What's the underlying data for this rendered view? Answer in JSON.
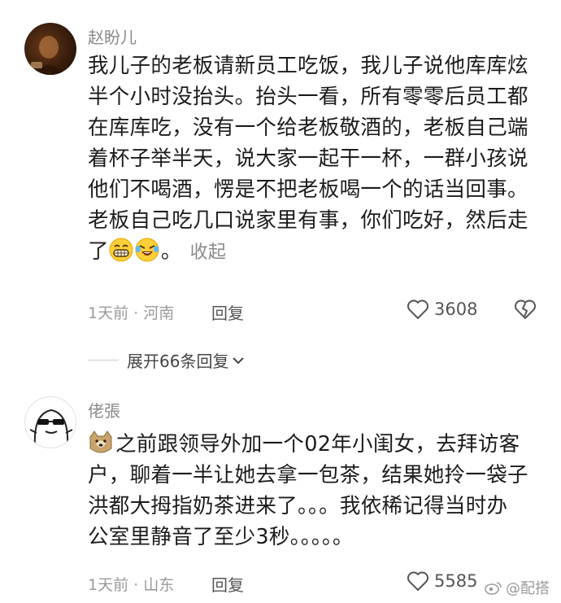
{
  "comments": [
    {
      "username": "赵盼儿",
      "text_lines": [
        "我儿子的老板请新员工吃饭，我儿子说他库库炫",
        "半个小时没抬头。抬头一看，所有零零后员工都",
        "在库库吃，没有一个给老板敬酒的，老板自己端",
        "着杯子举半天，说大家一起干一杯，一群小孩说",
        "他们不喝酒，愣是不把老板喝一个的话当回事。",
        "老板自己吃几口说家里有事，你们吃好，然后走",
        "了"
      ],
      "trailing_emojis": [
        "grinning-teeth-emoji",
        "rolling-laughing-emoji"
      ],
      "trailing_text": "。",
      "collapse_label": "收起",
      "time": "1天前",
      "location": "河南",
      "meta_separator": " · ",
      "reply_label": "回复",
      "likes": "3608"
    },
    {
      "username": "佬張",
      "leading_emoji": "doge-emoji",
      "text_lines": [
        "之前跟领导外加一个02年小闺女，去拜访客",
        "户，聊着一半让她去拿一包茶，结果她拎一袋子",
        "洪都大拇指奶茶进来了。。。我依稀记得当时办",
        "公室里静音了至少3秒。。。。。"
      ],
      "time": "1天前",
      "location": "山东",
      "meta_separator": " · ",
      "reply_label": "回复",
      "likes": "5585"
    }
  ],
  "expand_replies_label": "展开66条回复",
  "watermark": "@配搭",
  "colors": {
    "text": "#1c1c1c",
    "muted": "#8a8a8a",
    "background": "#ffffff"
  }
}
